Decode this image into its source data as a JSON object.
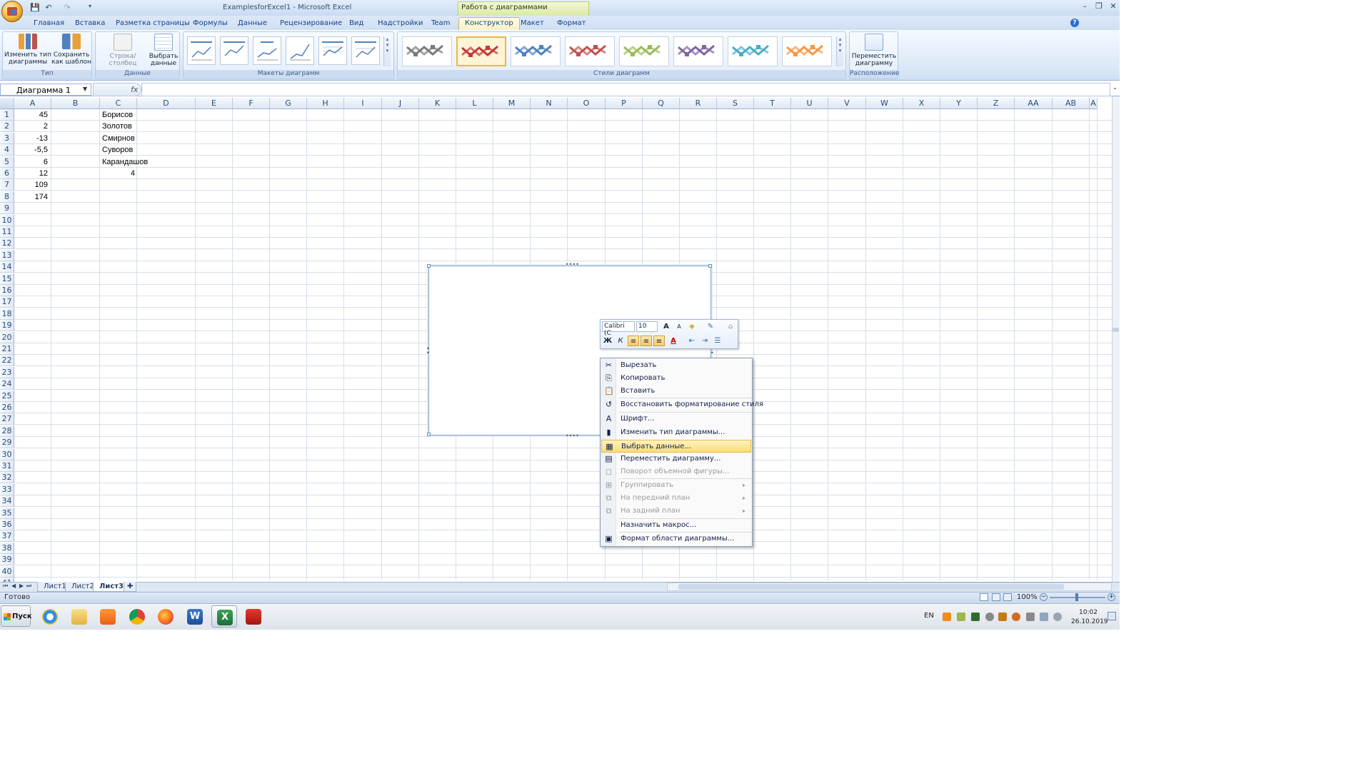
{
  "window": {
    "title": "ExamplesforExcel1 - Microsoft Excel",
    "context_tab_group": "Работа с диаграммами",
    "help": "?",
    "minimize": "–",
    "restore": "❐",
    "close": "✕"
  },
  "tabs": [
    "Главная",
    "Вставка",
    "Разметка страницы",
    "Формулы",
    "Данные",
    "Рецензирование",
    "Вид",
    "Надстройки",
    "Team",
    "Конструктор",
    "Макет",
    "Формат"
  ],
  "active_tab": "Конструктор",
  "ribbon": {
    "groups": {
      "type": {
        "label": "Тип",
        "change_type_label": "Изменить тип диаграммы",
        "save_template_label": "Сохранить как шаблон"
      },
      "data": {
        "label": "Данные",
        "row_col_label": "Строка/столбец",
        "select_data_label": "Выбрать данные"
      },
      "layouts": {
        "label": "Макеты диаграмм"
      },
      "styles": {
        "label": "Стили диаграмм"
      },
      "location": {
        "label": "Расположение",
        "move_chart_label": "Переместить диаграмму"
      }
    },
    "style_colors": [
      "#7a7a7a",
      "#c0393b",
      "#4f81bd",
      "#c0504d",
      "#9bbb59",
      "#8064a2",
      "#4bacc6",
      "#f79646"
    ]
  },
  "formula_bar": {
    "name_box": "Диаграмма 1",
    "fx": "fx",
    "value": ""
  },
  "columns": [
    "A",
    "B",
    "C",
    "D",
    "E",
    "F",
    "G",
    "H",
    "I",
    "J",
    "K",
    "L",
    "M",
    "N",
    "O",
    "P",
    "Q",
    "R",
    "S",
    "T",
    "U",
    "V",
    "W",
    "X",
    "Y",
    "Z",
    "AA",
    "AB",
    "A"
  ],
  "rows": [
    "1",
    "2",
    "3",
    "4",
    "5",
    "6",
    "7",
    "8",
    "9",
    "10",
    "11",
    "12",
    "13",
    "14",
    "15",
    "16",
    "17",
    "18",
    "19",
    "20",
    "21",
    "22",
    "23",
    "24",
    "25",
    "26",
    "27",
    "28",
    "29",
    "30",
    "31",
    "32",
    "33",
    "34",
    "35",
    "36",
    "37",
    "38",
    "39",
    "40",
    "41"
  ],
  "cells": {
    "A": [
      "45",
      "2",
      "-13",
      "-5,5",
      "6",
      "12",
      "109",
      "174"
    ],
    "C": [
      "Борисов",
      "Золотов",
      "Смирнов",
      "Суворов",
      "Карандашов"
    ],
    "C6": "4"
  },
  "mini_toolbar": {
    "font": "Calibri (С",
    "size": "10",
    "bold": "Ж",
    "italic": "К"
  },
  "context_menu": {
    "items": [
      {
        "label": "Вырезать",
        "icon": "scissors-icon",
        "glyph": "✂",
        "enabled": true
      },
      {
        "label": "Копировать",
        "icon": "copy-icon",
        "glyph": "⎘",
        "enabled": true
      },
      {
        "label": "Вставить",
        "icon": "paste-icon",
        "glyph": "📋",
        "enabled": true
      },
      {
        "label": "Восстановить форматирование стиля",
        "icon": "reset-style-icon",
        "glyph": "↺",
        "enabled": true
      },
      {
        "label": "Шрифт...",
        "icon": "font-icon",
        "glyph": "A",
        "enabled": true
      },
      {
        "label": "Изменить тип диаграммы...",
        "icon": "chart-type-icon",
        "glyph": "▮",
        "enabled": true
      },
      {
        "label": "Выбрать данные...",
        "icon": "select-data-icon",
        "glyph": "▦",
        "enabled": true,
        "highlighted": true
      },
      {
        "label": "Переместить диаграмму...",
        "icon": "move-chart-icon",
        "glyph": "▤",
        "enabled": true
      },
      {
        "label": "Поворот объемной фигуры...",
        "icon": "rotate-3d-icon",
        "glyph": "◻",
        "enabled": false
      },
      {
        "label": "Группировать",
        "icon": "group-icon",
        "glyph": "⊞",
        "enabled": false,
        "submenu": true
      },
      {
        "label": "На передний план",
        "icon": "bring-front-icon",
        "glyph": "⧉",
        "enabled": false,
        "submenu": true
      },
      {
        "label": "На задний план",
        "icon": "send-back-icon",
        "glyph": "⧉",
        "enabled": false,
        "submenu": true
      },
      {
        "label": "Назначить макрос...",
        "icon": "macro-icon",
        "glyph": "",
        "enabled": true
      },
      {
        "label": "Формат области диаграммы...",
        "icon": "format-area-icon",
        "glyph": "▣",
        "enabled": true
      }
    ],
    "submenu_glyph": "▸"
  },
  "sheets": [
    "Лист1",
    "Лист2",
    "Лист3"
  ],
  "active_sheet": "Лист3",
  "status": {
    "ready": "Готово",
    "zoom": "100%"
  },
  "taskbar": {
    "start_label": "Пуск",
    "language": "EN",
    "time": "10:02",
    "date": "26.10.2019"
  }
}
